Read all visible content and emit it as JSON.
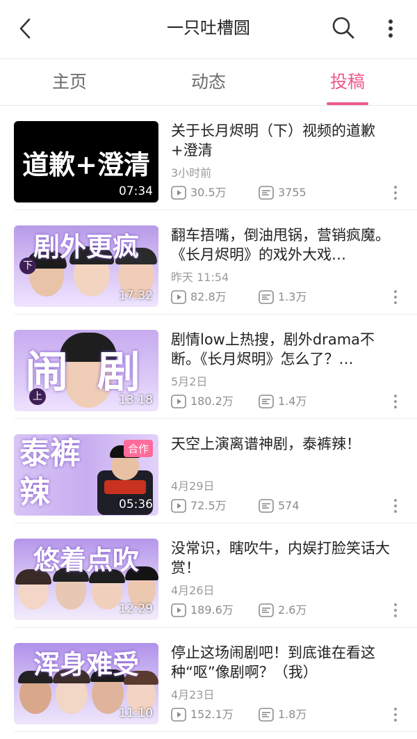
{
  "header": {
    "title": "一只吐槽圆"
  },
  "tabs": [
    {
      "label": "主页",
      "active": false
    },
    {
      "label": "动态",
      "active": false
    },
    {
      "label": "投稿",
      "active": true
    }
  ],
  "accent_color": "#ef5a8a",
  "videos": [
    {
      "title": "关于长月烬明（下）视频的道歉+澄清",
      "time": "3小时前",
      "plays": "30.5万",
      "danmaku": "3755",
      "duration": "07:34",
      "thumb_text": "道歉+澄清"
    },
    {
      "title": "翻车捂嘴，倒油甩锅，营销疯魔。《长月烬明》的戏外大戏…",
      "time": "昨天 11:54",
      "plays": "82.8万",
      "danmaku": "1.3万",
      "duration": "17:32",
      "thumb_text": "剧外更疯",
      "thumb_tag": "下"
    },
    {
      "title": "剧情low上热搜，剧外drama不断。《长月烬明》怎么了？…",
      "time": "5月2日",
      "plays": "180.2万",
      "danmaku": "1.4万",
      "duration": "13:18",
      "thumb_text": "闹 剧",
      "thumb_tag": "上"
    },
    {
      "title": "天空上演离谱神剧，泰裤辣！",
      "time": "4月29日",
      "plays": "72.5万",
      "danmaku": "574",
      "duration": "05:36",
      "thumb_text": "泰裤辣",
      "thumb_badge": "合作"
    },
    {
      "title": "没常识，瞎吹牛，内娱打脸笑话大赏！",
      "time": "4月26日",
      "plays": "189.6万",
      "danmaku": "2.6万",
      "duration": "12:29",
      "thumb_text": "悠着点吹"
    },
    {
      "title": "停止这场闹剧吧！到底谁在看这种“呕”像剧啊？（我）",
      "time": "4月23日",
      "plays": "152.1万",
      "danmaku": "1.8万",
      "duration": "11:10",
      "thumb_text": "浑身难受"
    }
  ]
}
